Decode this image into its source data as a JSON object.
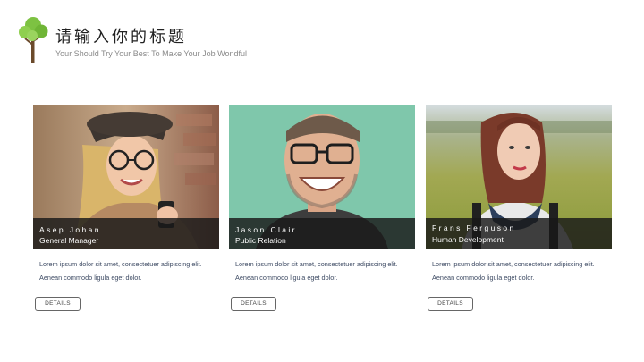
{
  "header": {
    "title": "请输入你的标题",
    "subtitle": "Your Should Try Your Best To Make Your Job Wondful",
    "logo_icon": "tree-icon",
    "accent_color": "#7dc242"
  },
  "cards": [
    {
      "name": "Asep Johan",
      "role": "General Manager",
      "description": "Lorem ipsum dolor sit amet, consectetuer adipiscing elit. Aenean commodo ligula eget dolor.",
      "button_label": "DETAILS",
      "photo": "portrait-woman-glasses-phone"
    },
    {
      "name": "Jason Clair",
      "role": "Public Relation",
      "description": "Lorem ipsum dolor sit amet, consectetuer adipiscing elit. Aenean commodo ligula eget dolor.",
      "button_label": "DETAILS",
      "photo": "portrait-man-glasses-smiling"
    },
    {
      "name": "Frans Ferguson",
      "role": "Human Development",
      "description": "Lorem ipsum dolor sit amet, consectetuer adipiscing elit. Aenean commodo ligula eget dolor.",
      "button_label": "DETAILS",
      "photo": "portrait-woman-field"
    }
  ]
}
